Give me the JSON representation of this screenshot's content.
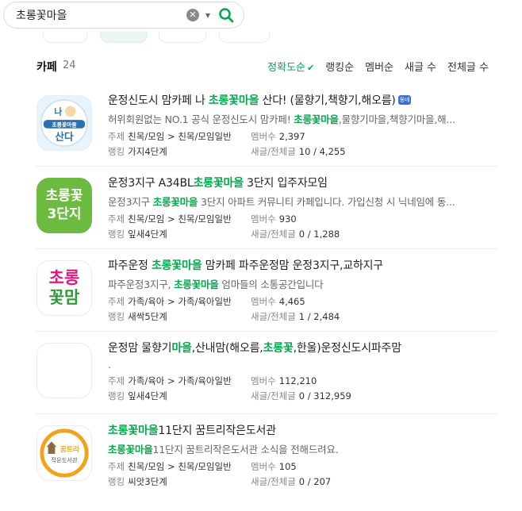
{
  "search": {
    "query": "초롱꽃마을"
  },
  "header": {
    "title": "카페",
    "count": "24",
    "sort_options": [
      "정확도순",
      "랭킹순",
      "멤버순",
      "새글 수",
      "전체글 수"
    ],
    "active_sort": "정확도순"
  },
  "labels": {
    "topic": "주제",
    "rank": "랭킹",
    "members": "멤버수",
    "posts": "새글/전체글"
  },
  "items": [
    {
      "title_parts": [
        "운정신도시 맘카페 나 ",
        "초롱꽃마을",
        " 산다! (물향기,책향기,해오름)"
      ],
      "title_badge": "동네",
      "desc_parts": [
        "허위회원없는 NO.1 공식 운정신도시 맘카페! ",
        "초롱꽃마을",
        ",물향기마을,책향기마을,해..."
      ],
      "topic": "친목/모임 > 친목/모임일반",
      "members": "2,397",
      "rank": "가지4단계",
      "posts": "10 / 4,255",
      "thumb": {
        "line1": "나",
        "line2": "초롱꽃마을",
        "line3": "산다",
        "bg": "#e8f3fb",
        "accent": "#2a6fb0"
      }
    },
    {
      "title_parts": [
        "운정3지구 A34BL",
        "초롱꽃마을",
        " 3단지 입주자모임"
      ],
      "desc_parts": [
        "운정3지구 ",
        "초롱꽃마을",
        " 3단지 아파트 커뮤니티 카페입니다. 가입신청 시 닉네임에 동..."
      ],
      "topic": "친목/모임 > 친목/모임일반",
      "members": "930",
      "rank": "잎새4단계",
      "posts": "0 / 1,288",
      "thumb": {
        "line1": "초롱꽃",
        "line2": "3단지",
        "bg": "#6cba3f",
        "fg": "#ffffff"
      }
    },
    {
      "title_parts": [
        "파주운정 ",
        "초롱꽃마을",
        " 맘카페 파주운정맘 운정3지구,교하지구"
      ],
      "desc_parts": [
        "파주운정3지구, ",
        "초롱꽃마을",
        " 엄마들의 소통공간입니다"
      ],
      "topic": "가족/육아 > 가족/육아일반",
      "members": "4,465",
      "rank": "새싹5단계",
      "posts": "1 / 2,484",
      "thumb": {
        "line1": "초롱",
        "line2": "꽃맘",
        "bg": "#ffffff",
        "fg1": "#e0197d",
        "fg2": "#2e9a3b"
      }
    },
    {
      "title_parts": [
        "운정맘 물향기",
        "마을",
        ",산내맘(해오름,",
        "초롱꽃",
        ",한울)운정신도시파주맘"
      ],
      "desc_parts": [
        "."
      ],
      "topic": "가족/육아 > 가족/육아일반",
      "members": "112,210",
      "rank": "잎새4단계",
      "posts": "0 / 312,959",
      "thumb": {
        "bg": "#ffffff"
      }
    },
    {
      "title_parts": [
        "초롱꽃마을",
        "11단지 꿈트리작은도서관"
      ],
      "desc_parts": [
        "초롱꽃마을",
        "11단지 꿈트리작은도서관 소식을 전해드려요."
      ],
      "topic": "친목/모임 > 친목/모임일반",
      "members": "105",
      "rank": "씨앗3단계",
      "posts": "0 / 207",
      "thumb": {
        "line1": "꿈트리",
        "line2": "작은도서관",
        "bg": "#ffffff",
        "ring": "#f3a21c"
      }
    }
  ],
  "colors": {
    "accent": "#03a94d",
    "text": "#222222",
    "muted": "#888888"
  }
}
